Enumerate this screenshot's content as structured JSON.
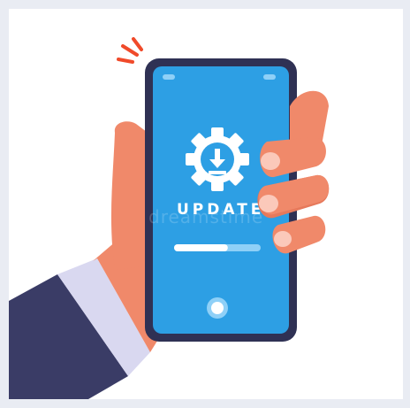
{
  "illustration": {
    "screen_label": "UPDATE",
    "watermark": "dreamstime",
    "progress_fraction": 0.62,
    "icons": {
      "gear": "gear-icon",
      "download": "download-arrow-icon",
      "home_button": "home-button-icon",
      "notification": "vibration-lines-icon"
    },
    "colors": {
      "background_outer": "#e9ecf3",
      "background": "#ffffff",
      "phone_body": "#2f3154",
      "screen": "#2d9fe4",
      "screen_detail": "#8fd0f7",
      "skin": "#f0896a",
      "skin_dark": "#e6795b",
      "nail": "#fbc9ba",
      "sleeve": "#3a3c66",
      "cuff": "#d9d8f0",
      "accent": "#f04a2a"
    }
  }
}
